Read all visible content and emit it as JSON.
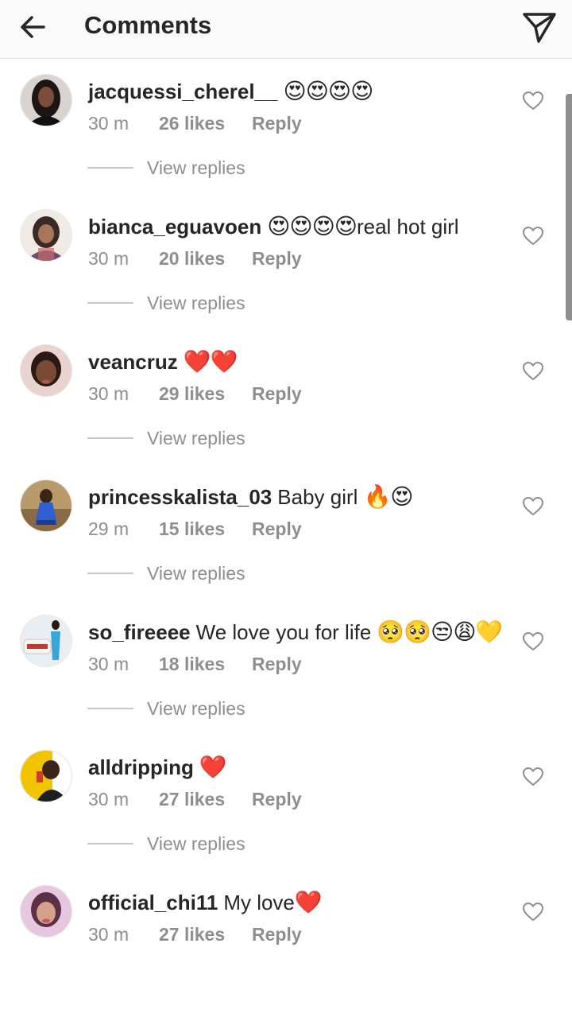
{
  "header": {
    "title": "Comments",
    "back_icon": "arrow-left-icon",
    "send_icon": "paper-plane-icon"
  },
  "comments": [
    {
      "username": "jacquessi_cherel__",
      "text": "",
      "emoji": "😍😍😍😍",
      "time": "30 m",
      "likes": "26 likes",
      "reply_label": "Reply",
      "view_replies": "View replies"
    },
    {
      "username": "bianca_eguavoen",
      "text": "",
      "emoji": "😍😍😍😍",
      "text_after": "real hot girl",
      "time": "30 m",
      "likes": "20 likes",
      "reply_label": "Reply",
      "view_replies": "View replies"
    },
    {
      "username": "veancruz",
      "text": "",
      "emoji": "❤️❤️",
      "time": "30 m",
      "likes": "29 likes",
      "reply_label": "Reply",
      "view_replies": "View replies"
    },
    {
      "username": "princesskalista_03",
      "text": "Baby girl",
      "emoji": "🔥😍",
      "time": "29 m",
      "likes": "15 likes",
      "reply_label": "Reply",
      "view_replies": "View replies"
    },
    {
      "username": "so_fireeee",
      "text": "We love you for life",
      "emoji": "🥺🥺😒😩💛",
      "time": "30 m",
      "likes": "18 likes",
      "reply_label": "Reply",
      "view_replies": "View replies"
    },
    {
      "username": "alldripping",
      "text": "",
      "emoji": "❤️",
      "time": "30 m",
      "likes": "27 likes",
      "reply_label": "Reply",
      "view_replies": "View replies"
    },
    {
      "username": "official_chi11",
      "text": "My love",
      "emoji": "❤️",
      "time": "30 m",
      "likes": "27 likes",
      "reply_label": "Reply",
      "view_replies": "View replies"
    }
  ],
  "colors": {
    "text": "#262626",
    "secondary": "#8e8e8e",
    "divider": "#dbdbdb",
    "heart": "#ed4956"
  }
}
